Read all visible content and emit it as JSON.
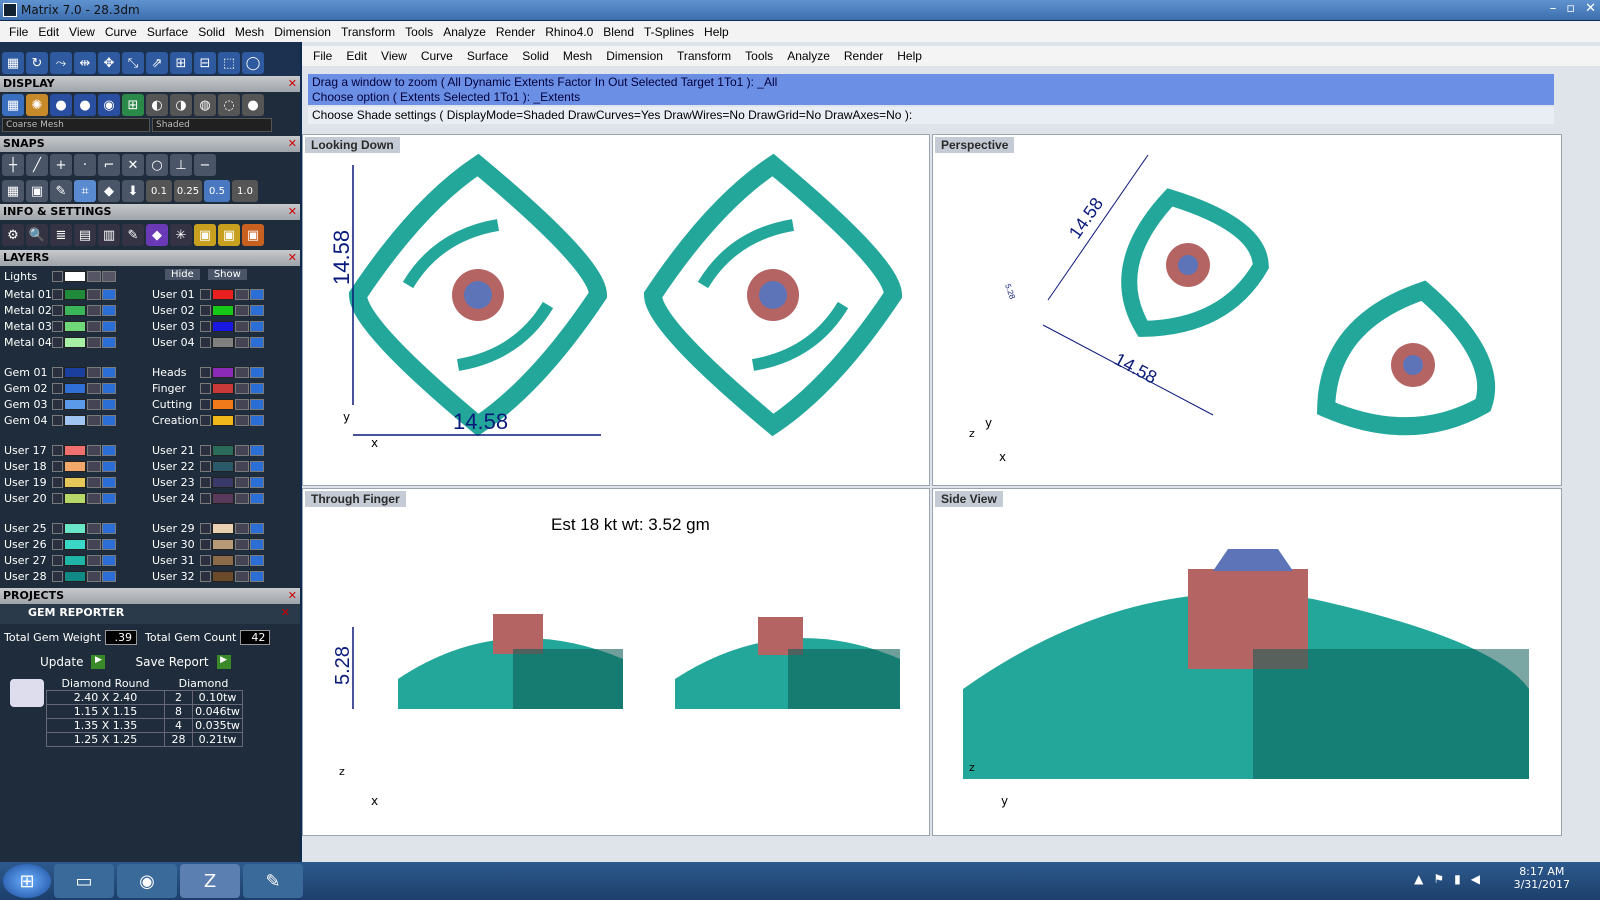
{
  "window": {
    "title": "Matrix 7.0 - 28.3dm",
    "buttons": [
      "–",
      "▫",
      "✕"
    ]
  },
  "menubar": [
    "File",
    "Edit",
    "View",
    "Curve",
    "Surface",
    "Solid",
    "Mesh",
    "Dimension",
    "Transform",
    "Tools",
    "Analyze",
    "Render",
    "Rhino4.0",
    "Blend",
    "T-Splines",
    "Help"
  ],
  "inner_menubar": [
    "File",
    "Edit",
    "View",
    "Curve",
    "Surface",
    "Solid",
    "Mesh",
    "Dimension",
    "Transform",
    "Tools",
    "Analyze",
    "Render",
    "Help"
  ],
  "command": {
    "history": [
      "Drag a window to zoom ( All  Dynamic  Extents  Factor  In  Out  Selected  Target  1To1 ): _All",
      "Choose option ( Extents  Selected  1To1 ): _Extents"
    ],
    "prompt": "Choose Shade settings ( DisplayMode=Shaded  DrawCurves=Yes  DrawWires=No  DrawGrid=No  DrawAxes=No ):"
  },
  "panels": {
    "display": "DISPLAY",
    "snaps": "SNAPS",
    "info": "INFO & SETTINGS",
    "layers": "LAYERS",
    "projects": "PROJECTS",
    "gem_reporter": "GEM REPORTER",
    "mesh_select": "Coarse Mesh",
    "shade_select": "Shaded",
    "snap_values": [
      "0.1",
      "0.25",
      "0.5",
      "1.0"
    ]
  },
  "layers": {
    "lights": "Lights",
    "hide": "Hide",
    "show": "Show",
    "left": [
      {
        "name": "Metal 01",
        "color": "#1f8a3a"
      },
      {
        "name": "Metal 02",
        "color": "#3ab55a"
      },
      {
        "name": "Metal 03",
        "color": "#6fd67a"
      },
      {
        "name": "Metal 04",
        "color": "#a6f0a6"
      },
      {
        "name": "Gem 01",
        "color": "#1a3f9e"
      },
      {
        "name": "Gem 02",
        "color": "#2f6fd6"
      },
      {
        "name": "Gem 03",
        "color": "#5a9ae8"
      },
      {
        "name": "Gem 04",
        "color": "#9fc4f2"
      },
      {
        "name": "User 17",
        "color": "#f07070"
      },
      {
        "name": "User 18",
        "color": "#f2a86a"
      },
      {
        "name": "User 19",
        "color": "#e6c85a"
      },
      {
        "name": "User 20",
        "color": "#b6d86a"
      },
      {
        "name": "User 25",
        "color": "#6ae6c8"
      },
      {
        "name": "User 26",
        "color": "#3ad6c8"
      },
      {
        "name": "User 27",
        "color": "#1fb6a8"
      },
      {
        "name": "User 28",
        "color": "#118a86"
      }
    ],
    "right": [
      {
        "name": "User 01",
        "color": "#e82020"
      },
      {
        "name": "User 02",
        "color": "#18c818"
      },
      {
        "name": "User 03",
        "color": "#1818e0"
      },
      {
        "name": "User 04",
        "color": "#808080"
      },
      {
        "name": "Heads",
        "color": "#8a2ab6"
      },
      {
        "name": "Finger",
        "color": "#c83a3a"
      },
      {
        "name": "Cutting",
        "color": "#f07a1a"
      },
      {
        "name": "Creation",
        "color": "#f0b81a"
      },
      {
        "name": "User 21",
        "color": "#2a6a5a"
      },
      {
        "name": "User 22",
        "color": "#2a5a6a"
      },
      {
        "name": "User 23",
        "color": "#3a3a6a"
      },
      {
        "name": "User 24",
        "color": "#5a3a5a"
      },
      {
        "name": "User 29",
        "color": "#e8d0b0"
      },
      {
        "name": "User 30",
        "color": "#b89a78"
      },
      {
        "name": "User 31",
        "color": "#8a6a48"
      },
      {
        "name": "User 32",
        "color": "#6a4a2a"
      }
    ]
  },
  "gem_reporter": {
    "total_weight_label": "Total Gem Weight",
    "total_weight": ".39",
    "total_count_label": "Total Gem Count",
    "total_count": "42",
    "update": "Update",
    "save_report": "Save Report",
    "headers": [
      "Diamond Round",
      "Diamond"
    ],
    "rows": [
      {
        "size": "2.40 X 2.40",
        "count": "2",
        "weight": "0.10tw"
      },
      {
        "size": "1.15 X 1.15",
        "count": "8",
        "weight": "0.046tw"
      },
      {
        "size": "1.35 X 1.35",
        "count": "4",
        "weight": "0.035tw"
      },
      {
        "size": "1.25 X 1.25",
        "count": "28",
        "weight": "0.21tw"
      }
    ]
  },
  "viewports": {
    "top_left": {
      "title": "Looking Down",
      "dim_w": "14.58",
      "dim_h": "14.58",
      "axis_x": "x",
      "axis_y": "y"
    },
    "top_right": {
      "title": "Perspective",
      "dim_a": "14.58",
      "dim_b": "14.58",
      "dim_c": "5.28",
      "axis_x": "x",
      "axis_y": "y",
      "axis_z": "z"
    },
    "bottom_left": {
      "title": "Through Finger",
      "estimate": "Est 18 kt wt: 3.52 gm",
      "dim_h": "5.28",
      "axis_x": "x",
      "axis_z": "z"
    },
    "bottom_right": {
      "title": "Side View",
      "axis_y": "y",
      "axis_z": "z"
    }
  },
  "colors": {
    "metal": "#23a79a",
    "metal_dark": "#0d5f58",
    "head": "#b56464",
    "gem": "#5d74b8"
  },
  "taskbar": {
    "time": "8:17 AM",
    "date": "3/31/2017"
  }
}
